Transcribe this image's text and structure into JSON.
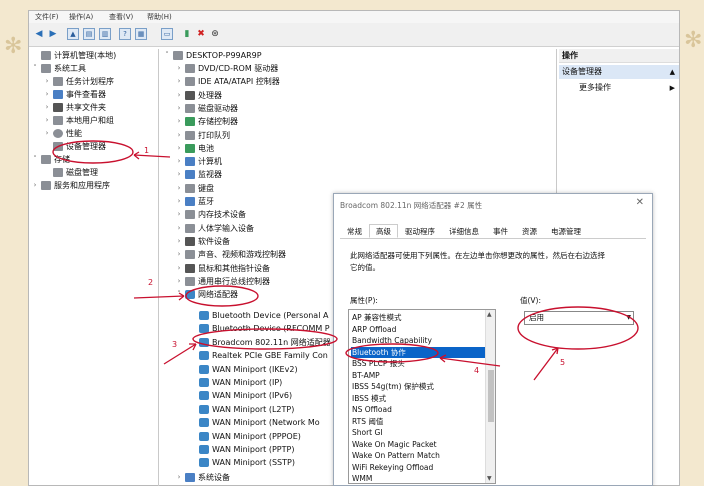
{
  "menubar": {
    "items": [
      "文件(F)",
      "操作(A)",
      "查看(V)",
      "帮助(H)"
    ]
  },
  "toolbar": {
    "back_icon": "arrow-left-icon",
    "forward_icon": "arrow-right-icon",
    "delete_icon": "red-x-icon",
    "download_icon": "download-icon"
  },
  "left_tree": {
    "root": "计算机管理(本地)",
    "system_tools": "系统工具",
    "items": [
      "任务计划程序",
      "事件查看器",
      "共享文件夹",
      "本地用户和组",
      "性能",
      "设备管理器"
    ],
    "storage": "存储",
    "disk_management": "磁盘管理",
    "services": "服务和应用程序"
  },
  "device_tree": {
    "root": "DESKTOP-P99AR9P",
    "categories": [
      "DVD/CD-ROM 驱动器",
      "IDE ATA/ATAPI 控制器",
      "处理器",
      "磁盘驱动器",
      "存储控制器",
      "打印队列",
      "电池",
      "计算机",
      "监视器",
      "键盘",
      "蓝牙",
      "内存技术设备",
      "人体学输入设备",
      "软件设备",
      "声音、视频和游戏控制器",
      "鼠标和其他指针设备",
      "通用串行总线控制器",
      "网络适配器"
    ],
    "adapters": [
      "Bluetooth Device (Personal A",
      "Bluetooth Device (RFCOMM P",
      "Broadcom 802.11n 网络适配器",
      "Realtek PCIe GBE Family Con",
      "WAN Miniport (IKEv2)",
      "WAN Miniport (IP)",
      "WAN Miniport (IPv6)",
      "WAN Miniport (L2TP)",
      "WAN Miniport (Network Mo",
      "WAN Miniport (PPPOE)",
      "WAN Miniport (PPTP)",
      "WAN Miniport (SSTP)"
    ],
    "last": "系统设备"
  },
  "actions": {
    "header": "操作",
    "selected": "设备管理器",
    "more": "更多操作"
  },
  "dialog": {
    "title": "Broadcom 802.11n 网络适配器 #2 属性",
    "close": "✕",
    "tabs": [
      "常规",
      "高级",
      "驱动程序",
      "详细信息",
      "事件",
      "资源",
      "电源管理"
    ],
    "active_tab": "高级",
    "description": "此网络适配器可使用下列属性。在左边单击你想更改的属性，然后在右边选择它的值。",
    "property_label": "属性(P):",
    "value_label": "值(V):",
    "properties": [
      "AP 兼容性模式",
      "ARP Offload",
      "Bandwidth Capability",
      "Bluetooth 协作",
      "BSS PLCP 报头",
      "BT-AMP",
      "IBSS 54g(tm) 保护模式",
      "IBSS 模式",
      "NS Offload",
      "RTS 阈值",
      "Short GI",
      "Wake On Magic Packet",
      "Wake On Pattern Match",
      "WiFi Rekeying Offload",
      "WMM"
    ],
    "selected_property": "Bluetooth 协作",
    "value": "启用"
  },
  "annotations": {
    "a1": "1",
    "a2": "2",
    "a3": "3",
    "a4": "4",
    "a5": "5"
  },
  "colors": {
    "annotation": "#c8102e",
    "selection": "#0a64c8",
    "background": "#f3e8cf"
  }
}
